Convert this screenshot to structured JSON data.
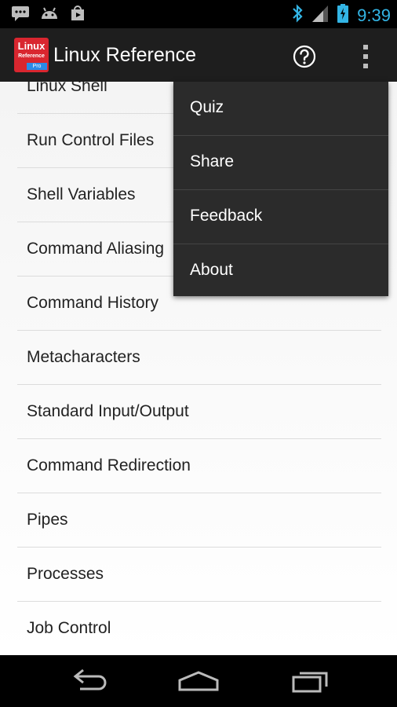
{
  "status_bar": {
    "time": "9:39",
    "icons": [
      "chat-icon",
      "android-icon",
      "play-store-icon",
      "bluetooth-icon",
      "signal-icon",
      "battery-icon"
    ]
  },
  "action_bar": {
    "app_icon_text": [
      "Linux",
      "Reference",
      "Pro"
    ],
    "title": "Linux Reference",
    "actions": [
      "help-icon",
      "overflow-menu-icon"
    ]
  },
  "list": {
    "items": [
      "Linux Shell",
      "Run Control Files",
      "Shell Variables",
      "Command Aliasing",
      "Command History",
      "Metacharacters",
      "Standard Input/Output",
      "Command Redirection",
      "Pipes",
      "Processes",
      "Job Control"
    ]
  },
  "menu": {
    "items": [
      "Quiz",
      "Share",
      "Feedback",
      "About"
    ]
  },
  "nav_bar": {
    "buttons": [
      "back-icon",
      "home-icon",
      "recent-apps-icon"
    ]
  },
  "colors": {
    "status_time": "#33b5e5",
    "action_bar": "#1e1e1e",
    "menu_bg": "#2b2b2b",
    "app_icon_red": "#d9262f"
  }
}
